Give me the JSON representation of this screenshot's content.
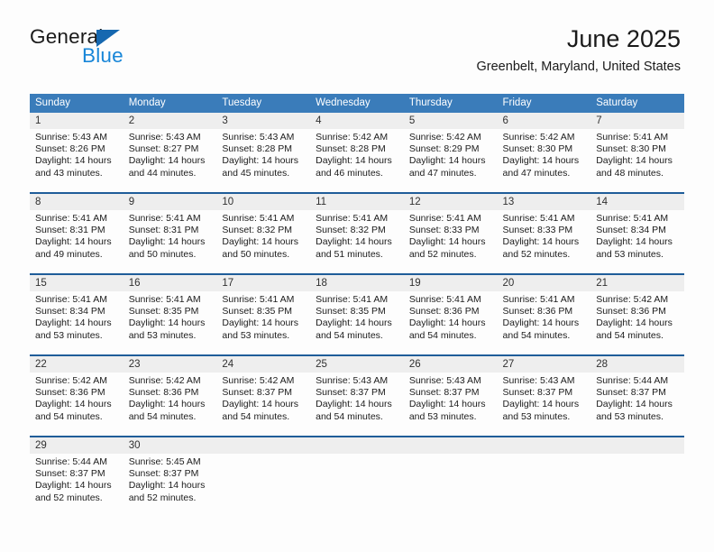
{
  "brand": {
    "name_part1": "General",
    "name_part2": "Blue",
    "triangle_icon": "triangle-right-icon",
    "accent_dark": "#1668b0",
    "accent_light": "#1886d8"
  },
  "header": {
    "title": "June 2025",
    "location": "Greenbelt, Maryland, United States"
  },
  "theme": {
    "header_blue": "#3a7cba",
    "week_separator": "#1f5d99",
    "day_strip_gray": "#eeeeee",
    "page_background": "#fdfdfd"
  },
  "columns": [
    "Sunday",
    "Monday",
    "Tuesday",
    "Wednesday",
    "Thursday",
    "Friday",
    "Saturday"
  ],
  "labels": {
    "sunrise_prefix": "Sunrise:",
    "sunset_prefix": "Sunset:",
    "daylight_prefix": "Daylight:"
  },
  "weeks": [
    {
      "days": [
        {
          "num": "1",
          "l1": "Sunrise: 5:43 AM",
          "l2": "Sunset: 8:26 PM",
          "l3": "Daylight: 14 hours",
          "l4": "and 43 minutes."
        },
        {
          "num": "2",
          "l1": "Sunrise: 5:43 AM",
          "l2": "Sunset: 8:27 PM",
          "l3": "Daylight: 14 hours",
          "l4": "and 44 minutes."
        },
        {
          "num": "3",
          "l1": "Sunrise: 5:43 AM",
          "l2": "Sunset: 8:28 PM",
          "l3": "Daylight: 14 hours",
          "l4": "and 45 minutes."
        },
        {
          "num": "4",
          "l1": "Sunrise: 5:42 AM",
          "l2": "Sunset: 8:28 PM",
          "l3": "Daylight: 14 hours",
          "l4": "and 46 minutes."
        },
        {
          "num": "5",
          "l1": "Sunrise: 5:42 AM",
          "l2": "Sunset: 8:29 PM",
          "l3": "Daylight: 14 hours",
          "l4": "and 47 minutes."
        },
        {
          "num": "6",
          "l1": "Sunrise: 5:42 AM",
          "l2": "Sunset: 8:30 PM",
          "l3": "Daylight: 14 hours",
          "l4": "and 47 minutes."
        },
        {
          "num": "7",
          "l1": "Sunrise: 5:41 AM",
          "l2": "Sunset: 8:30 PM",
          "l3": "Daylight: 14 hours",
          "l4": "and 48 minutes."
        }
      ]
    },
    {
      "days": [
        {
          "num": "8",
          "l1": "Sunrise: 5:41 AM",
          "l2": "Sunset: 8:31 PM",
          "l3": "Daylight: 14 hours",
          "l4": "and 49 minutes."
        },
        {
          "num": "9",
          "l1": "Sunrise: 5:41 AM",
          "l2": "Sunset: 8:31 PM",
          "l3": "Daylight: 14 hours",
          "l4": "and 50 minutes."
        },
        {
          "num": "10",
          "l1": "Sunrise: 5:41 AM",
          "l2": "Sunset: 8:32 PM",
          "l3": "Daylight: 14 hours",
          "l4": "and 50 minutes."
        },
        {
          "num": "11",
          "l1": "Sunrise: 5:41 AM",
          "l2": "Sunset: 8:32 PM",
          "l3": "Daylight: 14 hours",
          "l4": "and 51 minutes."
        },
        {
          "num": "12",
          "l1": "Sunrise: 5:41 AM",
          "l2": "Sunset: 8:33 PM",
          "l3": "Daylight: 14 hours",
          "l4": "and 52 minutes."
        },
        {
          "num": "13",
          "l1": "Sunrise: 5:41 AM",
          "l2": "Sunset: 8:33 PM",
          "l3": "Daylight: 14 hours",
          "l4": "and 52 minutes."
        },
        {
          "num": "14",
          "l1": "Sunrise: 5:41 AM",
          "l2": "Sunset: 8:34 PM",
          "l3": "Daylight: 14 hours",
          "l4": "and 53 minutes."
        }
      ]
    },
    {
      "days": [
        {
          "num": "15",
          "l1": "Sunrise: 5:41 AM",
          "l2": "Sunset: 8:34 PM",
          "l3": "Daylight: 14 hours",
          "l4": "and 53 minutes."
        },
        {
          "num": "16",
          "l1": "Sunrise: 5:41 AM",
          "l2": "Sunset: 8:35 PM",
          "l3": "Daylight: 14 hours",
          "l4": "and 53 minutes."
        },
        {
          "num": "17",
          "l1": "Sunrise: 5:41 AM",
          "l2": "Sunset: 8:35 PM",
          "l3": "Daylight: 14 hours",
          "l4": "and 53 minutes."
        },
        {
          "num": "18",
          "l1": "Sunrise: 5:41 AM",
          "l2": "Sunset: 8:35 PM",
          "l3": "Daylight: 14 hours",
          "l4": "and 54 minutes."
        },
        {
          "num": "19",
          "l1": "Sunrise: 5:41 AM",
          "l2": "Sunset: 8:36 PM",
          "l3": "Daylight: 14 hours",
          "l4": "and 54 minutes."
        },
        {
          "num": "20",
          "l1": "Sunrise: 5:41 AM",
          "l2": "Sunset: 8:36 PM",
          "l3": "Daylight: 14 hours",
          "l4": "and 54 minutes."
        },
        {
          "num": "21",
          "l1": "Sunrise: 5:42 AM",
          "l2": "Sunset: 8:36 PM",
          "l3": "Daylight: 14 hours",
          "l4": "and 54 minutes."
        }
      ]
    },
    {
      "days": [
        {
          "num": "22",
          "l1": "Sunrise: 5:42 AM",
          "l2": "Sunset: 8:36 PM",
          "l3": "Daylight: 14 hours",
          "l4": "and 54 minutes."
        },
        {
          "num": "23",
          "l1": "Sunrise: 5:42 AM",
          "l2": "Sunset: 8:36 PM",
          "l3": "Daylight: 14 hours",
          "l4": "and 54 minutes."
        },
        {
          "num": "24",
          "l1": "Sunrise: 5:42 AM",
          "l2": "Sunset: 8:37 PM",
          "l3": "Daylight: 14 hours",
          "l4": "and 54 minutes."
        },
        {
          "num": "25",
          "l1": "Sunrise: 5:43 AM",
          "l2": "Sunset: 8:37 PM",
          "l3": "Daylight: 14 hours",
          "l4": "and 54 minutes."
        },
        {
          "num": "26",
          "l1": "Sunrise: 5:43 AM",
          "l2": "Sunset: 8:37 PM",
          "l3": "Daylight: 14 hours",
          "l4": "and 53 minutes."
        },
        {
          "num": "27",
          "l1": "Sunrise: 5:43 AM",
          "l2": "Sunset: 8:37 PM",
          "l3": "Daylight: 14 hours",
          "l4": "and 53 minutes."
        },
        {
          "num": "28",
          "l1": "Sunrise: 5:44 AM",
          "l2": "Sunset: 8:37 PM",
          "l3": "Daylight: 14 hours",
          "l4": "and 53 minutes."
        }
      ]
    },
    {
      "days": [
        {
          "num": "29",
          "l1": "Sunrise: 5:44 AM",
          "l2": "Sunset: 8:37 PM",
          "l3": "Daylight: 14 hours",
          "l4": "and 52 minutes."
        },
        {
          "num": "30",
          "l1": "Sunrise: 5:45 AM",
          "l2": "Sunset: 8:37 PM",
          "l3": "Daylight: 14 hours",
          "l4": "and 52 minutes."
        },
        {
          "num": "",
          "l1": "",
          "l2": "",
          "l3": "",
          "l4": ""
        },
        {
          "num": "",
          "l1": "",
          "l2": "",
          "l3": "",
          "l4": ""
        },
        {
          "num": "",
          "l1": "",
          "l2": "",
          "l3": "",
          "l4": ""
        },
        {
          "num": "",
          "l1": "",
          "l2": "",
          "l3": "",
          "l4": ""
        },
        {
          "num": "",
          "l1": "",
          "l2": "",
          "l3": "",
          "l4": ""
        }
      ]
    }
  ]
}
